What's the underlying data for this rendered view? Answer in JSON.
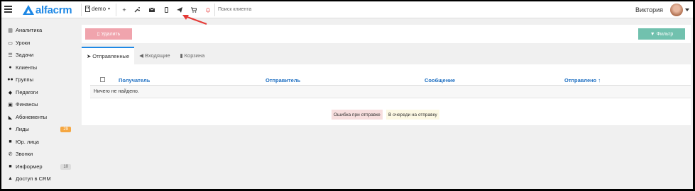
{
  "app": {
    "brand": "alfacrm"
  },
  "topbar": {
    "branch": "demo",
    "search_placeholder": "Поиск клиента",
    "user_name": "Виктория"
  },
  "sidebar": {
    "items": [
      {
        "label": "Аналитика",
        "icon": "chart-icon"
      },
      {
        "label": "Уроки",
        "icon": "calendar-icon"
      },
      {
        "label": "Задачи",
        "icon": "tasks-icon"
      },
      {
        "label": "Клиенты",
        "icon": "user-icon"
      },
      {
        "label": "Группы",
        "icon": "users-icon"
      },
      {
        "label": "Педагоги",
        "icon": "graduation-icon"
      },
      {
        "label": "Финансы",
        "icon": "money-icon"
      },
      {
        "label": "Абонементы",
        "icon": "tag-icon"
      },
      {
        "label": "Лиды",
        "icon": "user-plus-icon",
        "badge": "29"
      },
      {
        "label": "Юр. лица",
        "icon": "briefcase-icon"
      },
      {
        "label": "Звонки",
        "icon": "phone-icon"
      },
      {
        "label": "Информер",
        "icon": "informer-icon",
        "badge": "10"
      },
      {
        "label": "Доступ в CRM",
        "icon": "lock-icon"
      }
    ]
  },
  "toolbar": {
    "delete_label": "Удалить",
    "filter_label": "Фильтр"
  },
  "tabs": [
    {
      "label": "Отправленные",
      "active": true
    },
    {
      "label": "Входящие",
      "active": false
    },
    {
      "label": "Корзина",
      "active": false
    }
  ],
  "table": {
    "columns": [
      "Получатель",
      "Отправитель",
      "Сообщение",
      "Отправлено"
    ],
    "empty_text": "Ничего не найдено."
  },
  "legend": {
    "error_label": "Ошибка при отправке",
    "queue_label": "В очереди на отправку"
  },
  "colors": {
    "accent": "#1e88e5",
    "delete": "#f0a4ad",
    "filter": "#71c1ae",
    "badge_orange": "#f5a742",
    "error_bg": "#f7dede",
    "queue_bg": "#fcf8e3"
  }
}
